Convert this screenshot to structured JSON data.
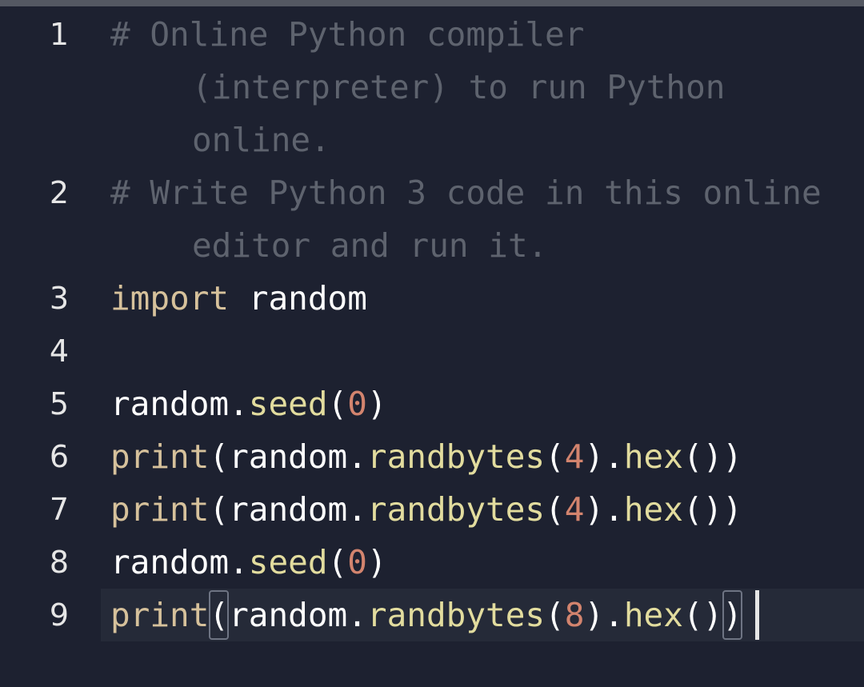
{
  "editor": {
    "lines": [
      {
        "number": "1",
        "rows": [
          "# Online Python compiler",
          "(interpreter) to run Python",
          "online."
        ]
      },
      {
        "number": "2",
        "rows": [
          "# Write Python 3 code in this online",
          "editor and run it."
        ]
      },
      {
        "number": "3",
        "tokens": [
          "import",
          " random"
        ]
      },
      {
        "number": "4",
        "tokens": []
      },
      {
        "number": "5",
        "tokens": [
          "random.",
          "seed",
          "(",
          "0",
          ")"
        ]
      },
      {
        "number": "6",
        "tokens": [
          "print",
          "(random.",
          "randbytes",
          "(",
          "4",
          ").",
          "hex",
          "())"
        ]
      },
      {
        "number": "7",
        "tokens": [
          "print",
          "(random.",
          "randbytes",
          "(",
          "4",
          ").",
          "hex",
          "())"
        ]
      },
      {
        "number": "8",
        "tokens": [
          "random.",
          "seed",
          "(",
          "0",
          ")"
        ]
      },
      {
        "number": "9",
        "tokens": [
          "print",
          "(",
          "random.",
          "randbytes",
          "(",
          "8",
          ").",
          "hex",
          "()",
          ")"
        ]
      }
    ]
  },
  "colors": {
    "background": "#1d2130",
    "comment": "#5e636e",
    "keyword": "#d6c19b",
    "function": "#e2dc9e",
    "number": "#d3846e",
    "text": "#ffffff",
    "active_line": "#252a38"
  }
}
